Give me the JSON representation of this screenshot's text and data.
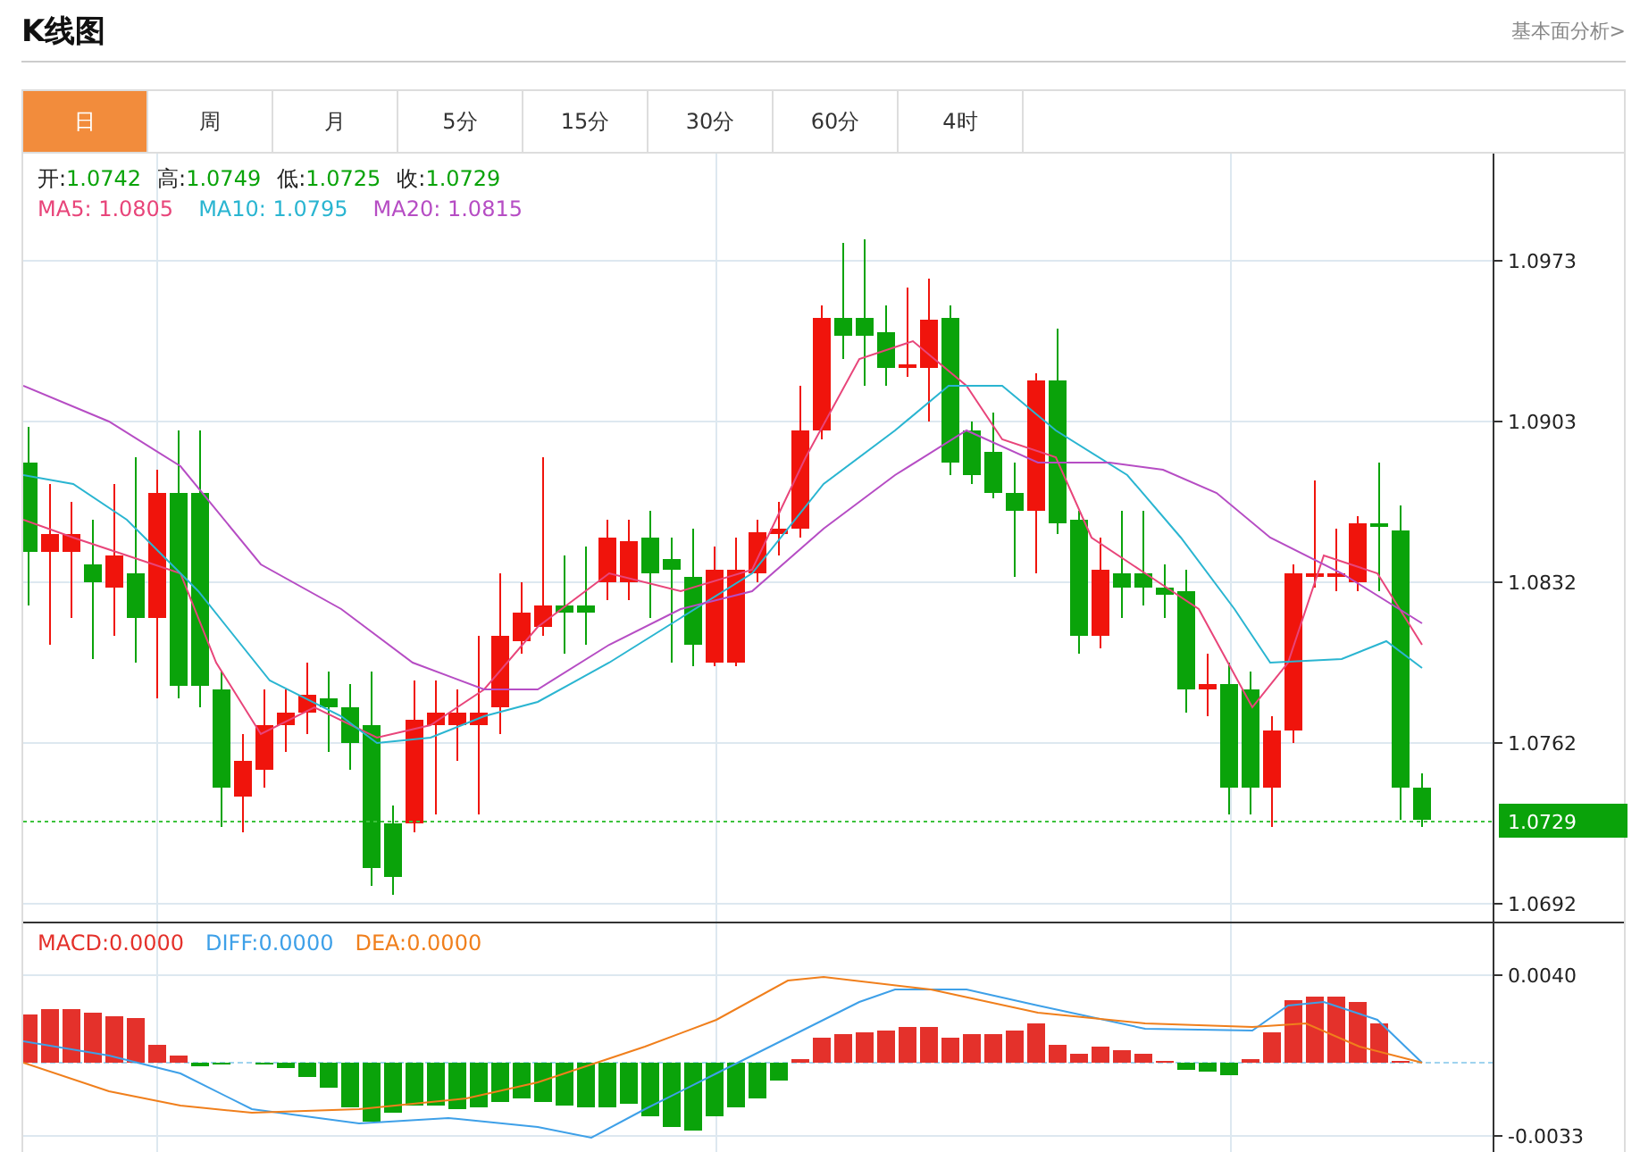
{
  "header": {
    "title": "K线图",
    "link": "基本面分析>"
  },
  "tabs": [
    {
      "label": "日",
      "selected": true
    },
    {
      "label": "周",
      "selected": false
    },
    {
      "label": "月",
      "selected": false
    },
    {
      "label": "5分",
      "selected": false
    },
    {
      "label": "15分",
      "selected": false
    },
    {
      "label": "30分",
      "selected": false
    },
    {
      "label": "60分",
      "selected": false
    },
    {
      "label": "4时",
      "selected": false
    }
  ],
  "quote": [
    {
      "label": "开:",
      "value": "1.0742"
    },
    {
      "label": "高:",
      "value": "1.0749"
    },
    {
      "label": "低:",
      "value": "1.0725"
    },
    {
      "label": "收:",
      "value": "1.0729"
    }
  ],
  "moving_averages": [
    {
      "label": "MA5:",
      "value": "1.0805",
      "color": "#e8457a"
    },
    {
      "label": "MA10:",
      "value": "1.0795",
      "color": "#2ab5d1"
    },
    {
      "label": "MA20:",
      "value": "1.0815",
      "color": "#b64dc4"
    }
  ],
  "price_axis": {
    "ticks": [
      "1.0973",
      "1.0903",
      "1.0832",
      "1.0762",
      "1.0692"
    ],
    "current_price": "1.0729"
  },
  "macd": {
    "legend": [
      {
        "label": "MACD:",
        "value": "0.0000",
        "color": "#e4312b"
      },
      {
        "label": "DIFF:",
        "value": "0.0000",
        "color": "#3ea0e8"
      },
      {
        "label": "DEA:",
        "value": "0.0000",
        "color": "#f07f1c"
      }
    ],
    "ticks": [
      "0.0040",
      "-0.0033"
    ]
  }
}
